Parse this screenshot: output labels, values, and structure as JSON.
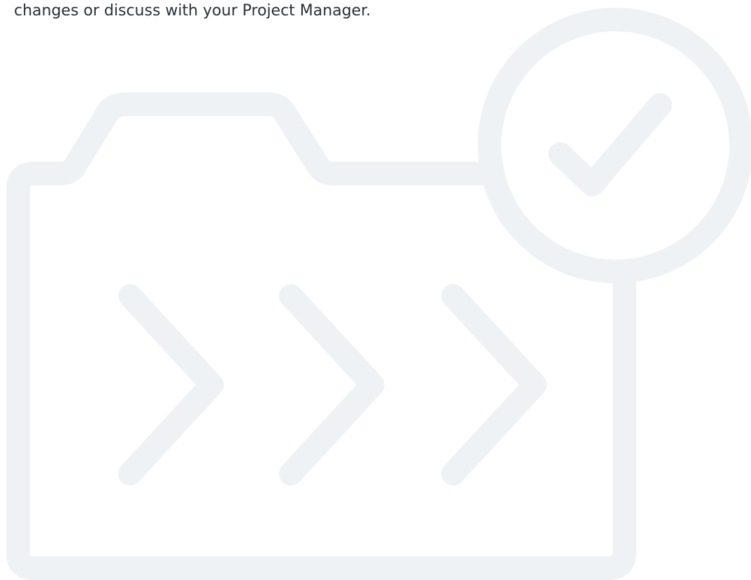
{
  "message": {
    "text": "changes or discuss with your Project Manager."
  },
  "illustration": {
    "icon": "folder-transfer-complete-icon",
    "stroke_color": "#eff2f5"
  }
}
